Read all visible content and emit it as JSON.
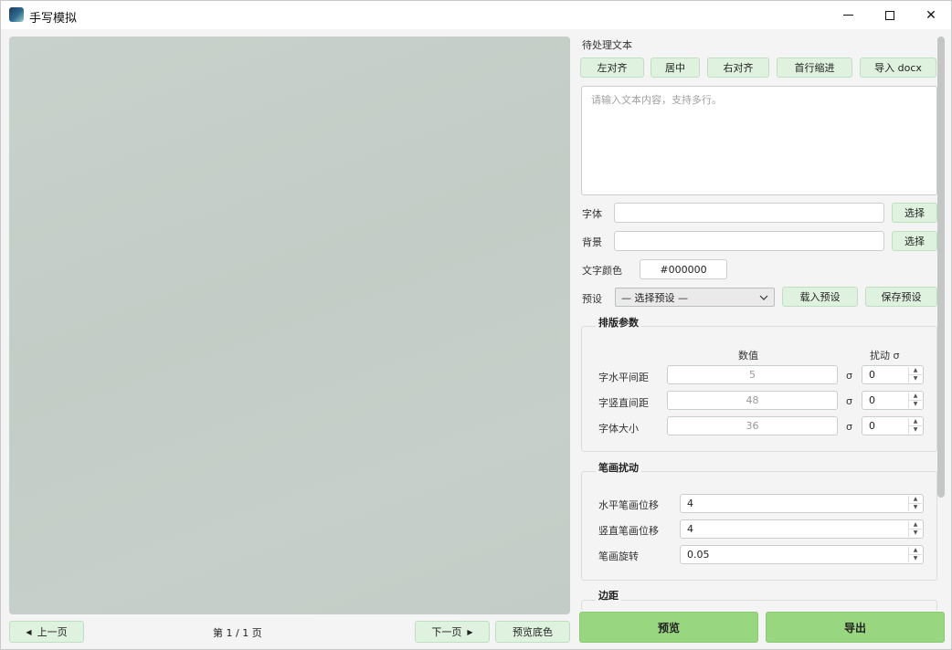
{
  "window": {
    "title": "手写模拟",
    "controls": {
      "minimize": "—",
      "maximize": "☐",
      "close": "✕"
    }
  },
  "preview": {
    "prev_label": "上一页",
    "next_label": "下一页",
    "page_info": "第 1 / 1 页",
    "bg_preview_label": "预览底色"
  },
  "text_section": {
    "title": "待处理文本",
    "buttons": [
      "左对齐",
      "居中",
      "右对齐",
      "首行缩进",
      "导入 docx"
    ],
    "placeholder": "请输入文本内容，支持多行。"
  },
  "font_row": {
    "label": "字体",
    "value": "",
    "button": "选择"
  },
  "background_row": {
    "label": "背景",
    "value": "",
    "button": "选择"
  },
  "color_row": {
    "label": "文字颜色",
    "value": "#000000"
  },
  "preset_row": {
    "label": "预设",
    "selected": "— 选择预设 —",
    "load_button": "载入预设",
    "save_button": "保存预设"
  },
  "layout_group": {
    "title": "排版参数",
    "col_value": "数值",
    "col_jitter": "扰动 σ",
    "sigma": "σ",
    "rows": [
      {
        "label": "字水平间距",
        "value": "5",
        "jitter": "0"
      },
      {
        "label": "字竖直间距",
        "value": "48",
        "jitter": "0"
      },
      {
        "label": "字体大小",
        "value": "36",
        "jitter": "0"
      }
    ]
  },
  "stroke_group": {
    "title": "笔画扰动",
    "rows": [
      {
        "label": "水平笔画位移",
        "value": "4"
      },
      {
        "label": "竖直笔画位移",
        "value": "4"
      },
      {
        "label": "笔画旋转",
        "value": "0.05"
      }
    ]
  },
  "margin_group": {
    "title": "边距"
  },
  "actions": {
    "preview": "预览",
    "export": "导出"
  },
  "colors": {
    "accent_green": "#98d67f",
    "light_green": "#dff2df"
  }
}
